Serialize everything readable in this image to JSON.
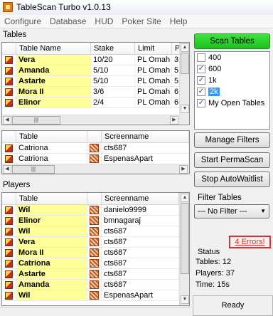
{
  "window": {
    "title": "TableScan Turbo v1.0.13"
  },
  "menu": [
    "Configure",
    "Database",
    "HUD",
    "Poker Site",
    "Help"
  ],
  "tables_section": {
    "label": "Tables",
    "columns": [
      "Table Name",
      "Stake",
      "Limit",
      "P"
    ],
    "rows": [
      {
        "name": "Vera",
        "stake": "10/20",
        "limit": "PL Omah",
        "p": "3"
      },
      {
        "name": "Amanda",
        "stake": "5/10",
        "limit": "PL Omah",
        "p": "5"
      },
      {
        "name": "Astarte",
        "stake": "5/10",
        "limit": "PL Omah",
        "p": "5"
      },
      {
        "name": "Mora II",
        "stake": "3/6",
        "limit": "PL Omah",
        "p": "6"
      },
      {
        "name": "Elinor",
        "stake": "2/4",
        "limit": "PL Omah",
        "p": "6"
      }
    ]
  },
  "seats_grid": {
    "columns": [
      "Table",
      "Screenname"
    ],
    "rows": [
      {
        "table": "Catriona",
        "screenname": "cts687"
      },
      {
        "table": "Catriona",
        "screenname": "EspenasApart"
      }
    ]
  },
  "players_section": {
    "label": "Players",
    "columns": [
      "Table",
      "Screenname"
    ],
    "rows": [
      {
        "table": "Wil",
        "screenname": "danielo9999"
      },
      {
        "table": "Elinor",
        "screenname": "bmnagaraj"
      },
      {
        "table": "Wil",
        "screenname": "cts687"
      },
      {
        "table": "Vera",
        "screenname": "cts687"
      },
      {
        "table": "Mora II",
        "screenname": "cts687"
      },
      {
        "table": "Catriona",
        "screenname": "cts687"
      },
      {
        "table": "Astarte",
        "screenname": "cts687"
      },
      {
        "table": "Amanda",
        "screenname": "cts687"
      },
      {
        "table": "Wil",
        "screenname": "EspenasApart"
      }
    ]
  },
  "buttons": {
    "scan": "Scan Tables",
    "manage": "Manage Filters",
    "perma": "Start PermaScan",
    "waitlist": "Stop AutoWaitlist"
  },
  "filters": [
    {
      "label": "400",
      "checked": false,
      "selected": false
    },
    {
      "label": "600",
      "checked": true,
      "selected": false
    },
    {
      "label": "1k",
      "checked": true,
      "selected": false
    },
    {
      "label": "2k",
      "checked": true,
      "selected": true
    },
    {
      "label": "My Open Tables",
      "checked": true,
      "selected": false
    }
  ],
  "filter_tables": {
    "label": "Filter Tables",
    "value": "--- No Filter ---"
  },
  "errors": "4 Errors!",
  "status": {
    "label": "Status",
    "tables": "Tables: 12",
    "players": "Players: 37",
    "time": "Time: 15s"
  },
  "statusbar": "Ready",
  "colors": {
    "accent_green": "#22cc22",
    "name_highlight": "#ffff99",
    "error_red": "#d93030",
    "selection": "#3399ff"
  },
  "icons": {
    "app": "tablescan-icon",
    "table_row": "poker-chip-icon",
    "player_row": "player-stats-icon"
  }
}
